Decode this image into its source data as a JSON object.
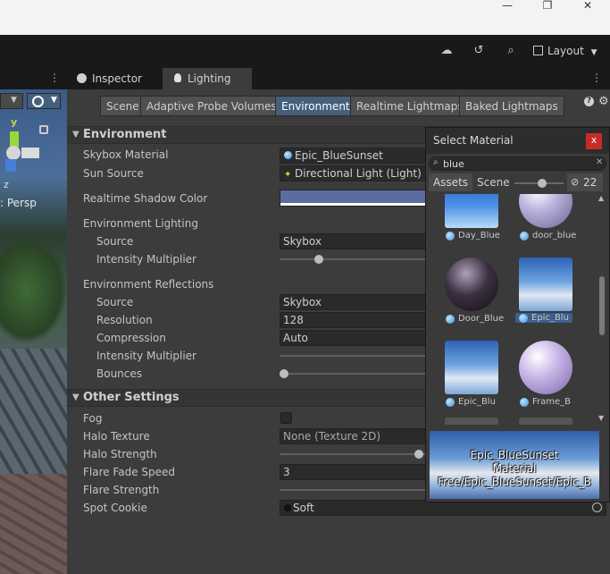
{
  "window": {
    "minimize": "—",
    "maximize": "❐",
    "close": "✕"
  },
  "toolbar": {
    "layout_label": "Layout"
  },
  "tabs": [
    {
      "label": "Inspector"
    },
    {
      "label": "Lighting"
    }
  ],
  "scene_view": {
    "gizmo_y": "y",
    "gizmo_z": "z",
    "persp_label": "Persp"
  },
  "subtabs": [
    {
      "label": "Scene"
    },
    {
      "label": "Adaptive Probe Volumes"
    },
    {
      "label": "Environment"
    },
    {
      "label": "Realtime Lightmaps"
    },
    {
      "label": "Baked Lightmaps"
    }
  ],
  "environment": {
    "header": "Environment",
    "skybox_material_label": "Skybox Material",
    "skybox_material_value": "Epic_BlueSunset",
    "sun_source_label": "Sun Source",
    "sun_source_value": "Directional Light (Light)",
    "shadow_color_label": "Realtime Shadow Color",
    "shadow_color": "#5a6d9e",
    "lighting_label": "Environment Lighting",
    "source_label": "Source",
    "source_value": "Skybox",
    "intensity_label": "Intensity Multiplier",
    "reflections_label": "Environment Reflections",
    "refl_source_label": "Source",
    "refl_source_value": "Skybox",
    "resolution_label": "Resolution",
    "resolution_value": "128",
    "compression_label": "Compression",
    "compression_value": "Auto",
    "refl_intensity_label": "Intensity Multiplier",
    "bounces_label": "Bounces"
  },
  "other_settings": {
    "header": "Other Settings",
    "fog_label": "Fog",
    "halo_texture_label": "Halo Texture",
    "halo_texture_value": "None (Texture 2D)",
    "halo_strength_label": "Halo Strength",
    "flare_fade_label": "Flare Fade Speed",
    "flare_fade_value": "3",
    "flare_strength_label": "Flare Strength",
    "spot_cookie_label": "Spot Cookie",
    "spot_cookie_value": "Soft"
  },
  "select_material": {
    "title": "Select Material",
    "close": "x",
    "search_value": "blue",
    "tab_assets": "Assets",
    "tab_scene": "Scene",
    "hidden_count": "22",
    "items": [
      {
        "label": "Day_Blue",
        "kind": "sky-day"
      },
      {
        "label": "door_blue",
        "kind": "sphere-lavender"
      },
      {
        "label": "Door_Blue",
        "kind": "sphere-dark"
      },
      {
        "label": "Epic_Blu",
        "kind": "sky-sunset",
        "selected": true
      },
      {
        "label": "Epic_Blu",
        "kind": "sky-sunset"
      },
      {
        "label": "Frame_B",
        "kind": "sphere-lavender"
      }
    ],
    "preview_name": "Epic_BlueSunset",
    "preview_type": "Material",
    "preview_path": "Free/Epic_BlueSunset/Epic_B"
  }
}
